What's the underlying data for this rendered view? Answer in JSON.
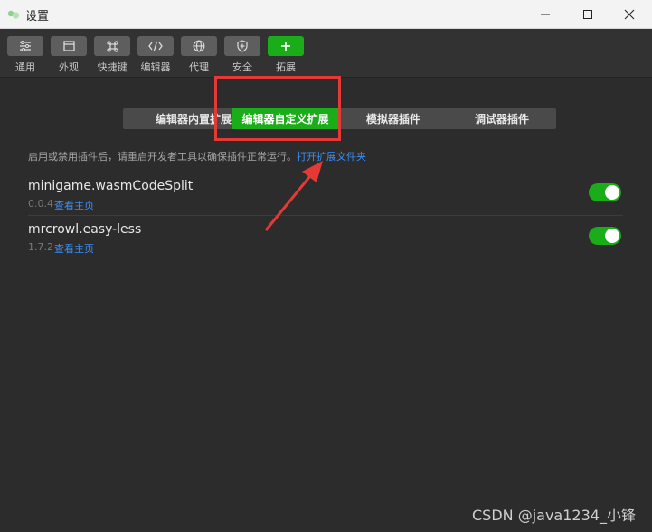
{
  "window": {
    "title": "设置"
  },
  "toolbar": {
    "items": [
      {
        "label": "通用",
        "icon": "sliders-icon"
      },
      {
        "label": "外观",
        "icon": "window-icon"
      },
      {
        "label": "快捷键",
        "icon": "command-icon"
      },
      {
        "label": "编辑器",
        "icon": "code-icon"
      },
      {
        "label": "代理",
        "icon": "globe-icon"
      },
      {
        "label": "安全",
        "icon": "shield-icon"
      },
      {
        "label": "拓展",
        "icon": "plus-icon",
        "active": true
      }
    ]
  },
  "tabs": [
    {
      "label": "编辑器内置扩展"
    },
    {
      "label": "编辑器自定义扩展",
      "active": true
    },
    {
      "label": "模拟器插件"
    },
    {
      "label": "调试器插件"
    }
  ],
  "hint": {
    "text": "启用或禁用插件后，请重启开发者工具以确保插件正常运行。",
    "link": "打开扩展文件夹"
  },
  "plugins": [
    {
      "name": "minigame.wasmCodeSplit",
      "version": "0.0.4",
      "link": "查看主页",
      "enabled": true
    },
    {
      "name": "mrcrowl.easy-less",
      "version": "1.7.2",
      "link": "查看主页",
      "enabled": true
    }
  ],
  "watermark": "CSDN @java1234_小锋",
  "colors": {
    "accent": "#1aad19",
    "link": "#3c8ff5",
    "annotation": "#e53935",
    "background": "#2c2c2c"
  }
}
